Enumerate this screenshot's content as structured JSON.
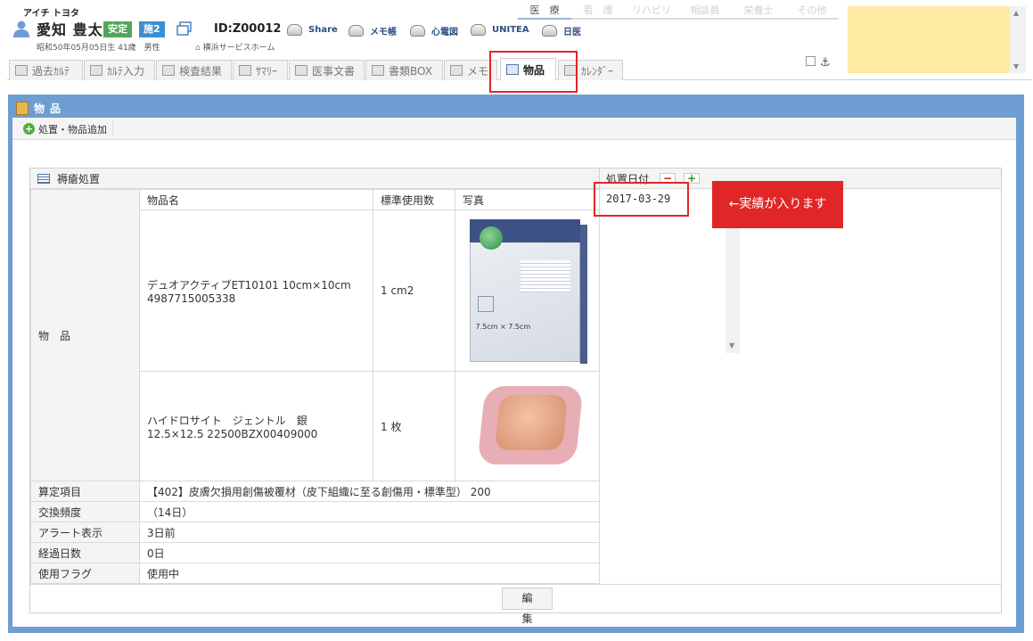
{
  "patient": {
    "kana": "アイチ トヨタ",
    "name": "愛知 豊太",
    "status_badge": "安定",
    "ward_badge": "施2",
    "id": "ID:Z00012",
    "birth_info": "昭和50年05月05日生 41歳　男性",
    "facility": "横浜サービスホーム"
  },
  "header_links": [
    "Share",
    "メモ帳",
    "心電図",
    "UNITEA",
    "日医"
  ],
  "category_tabs": [
    {
      "label": "医　療",
      "active": true
    },
    {
      "label": "看　護",
      "active": false
    },
    {
      "label": "リハビリ",
      "active": false
    },
    {
      "label": "相談員",
      "active": false
    },
    {
      "label": "栄養士",
      "active": false
    },
    {
      "label": "その他",
      "active": false
    }
  ],
  "tabs": [
    {
      "label": "過去ｶﾙﾃ",
      "icon": "past-records-icon"
    },
    {
      "label": "ｶﾙﾃ入力",
      "icon": "pencil-icon"
    },
    {
      "label": "検査結果",
      "icon": "bar-chart-icon"
    },
    {
      "label": "ｻﾏﾘｰ",
      "icon": "summary-icon"
    },
    {
      "label": "医事文書",
      "icon": "pdf-icon"
    },
    {
      "label": "書類BOX",
      "icon": "box-icon"
    },
    {
      "label": "メモ",
      "icon": "memo-icon"
    },
    {
      "label": "物品",
      "icon": "goods-icon",
      "active": true
    },
    {
      "label": "ｶﾚﾝﾀﾞｰ",
      "icon": "calendar-icon"
    }
  ],
  "panel": {
    "title": "物品",
    "add_button": "処置・物品追加"
  },
  "section": {
    "title": "褥瘡処置",
    "row_label": "物　品",
    "columns": [
      "物品名",
      "標準使用数",
      "写真"
    ],
    "items": [
      {
        "name_line1": "デュオアクティブET10101 10cm×10cm",
        "name_line2": "4987715005338",
        "qty": "1 cm2",
        "photo": "box-photo"
      },
      {
        "name_line1": "ハイドロサイト　ジェントル　銀",
        "name_line2": "12.5×12.5 22500BZX00409000",
        "qty": "1 枚",
        "photo": "dressing-photo"
      }
    ],
    "details": [
      {
        "label": "算定項目",
        "value": "【402】皮膚欠損用創傷被覆材（皮下組織に至る創傷用・標準型） 200"
      },
      {
        "label": "交換頻度",
        "value": "（14日）"
      },
      {
        "label": "アラート表示",
        "value": "3日前"
      },
      {
        "label": "経過日数",
        "value": "0日"
      },
      {
        "label": "使用フラグ",
        "value": "使用中"
      }
    ]
  },
  "treatment_dates": {
    "header": "処置日付",
    "dates": [
      "2017-03-29"
    ]
  },
  "annotation": "←実績が入ります",
  "edit_button": "編　集",
  "colors": {
    "panel": "#6e9ed1",
    "highlight": "#e02626",
    "badge_stable": "#52a65a",
    "badge_ward": "#3c8fd0",
    "note": "#feeaa2",
    "elapsed": "#e47c1a"
  }
}
